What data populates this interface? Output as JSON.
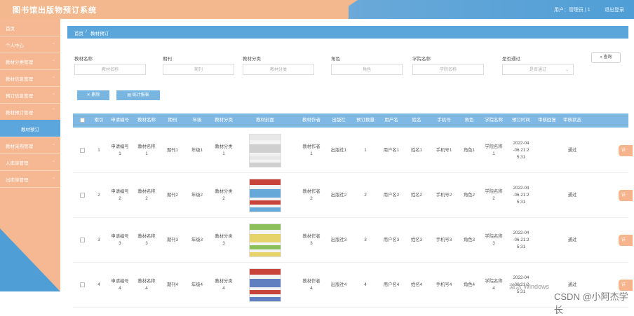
{
  "header": {
    "title": "图书馆出版物预订系统",
    "user": "用户：管理员 | 1",
    "logout": "退出登录"
  },
  "sidebar": {
    "items": [
      {
        "label": "首页",
        "chevron": ""
      },
      {
        "label": "个人中心",
        "chevron": "⌄"
      },
      {
        "label": "教材分类管理",
        "chevron": "⌄"
      },
      {
        "label": "教材信息管理",
        "chevron": "⌄"
      },
      {
        "label": "预订信息管理",
        "chevron": "⌄"
      },
      {
        "label": "教材预订管理",
        "chevron": "⌃"
      },
      {
        "label": "教材预订",
        "chevron": ""
      },
      {
        "label": "教材采购管理",
        "chevron": "⌄"
      },
      {
        "label": "入库单管理",
        "chevron": "⌄"
      },
      {
        "label": "出库单管理",
        "chevron": "⌄"
      }
    ]
  },
  "breadcrumb": {
    "home": "首页",
    "sep": "/",
    "current": "教材预订"
  },
  "filters": [
    {
      "label": "教材名称",
      "placeholder": "教材名称"
    },
    {
      "label": "期刊",
      "placeholder": "期刊"
    },
    {
      "label": "教材分类",
      "placeholder": "教材分类"
    },
    {
      "label": "角色",
      "placeholder": "角色"
    },
    {
      "label": "学院名称",
      "placeholder": "学院名称"
    },
    {
      "label": "是否通过",
      "placeholder": "是否通过"
    }
  ],
  "search_btn": "查询",
  "actions": {
    "delete": "删除",
    "export": "统计报表"
  },
  "columns": [
    "",
    "索引",
    "申请编号",
    "教材名称",
    "期刊",
    "年级",
    "教材分类",
    "教材封面",
    "教材作者",
    "出版社",
    "预订数量",
    "用户名",
    "姓名",
    "手机号",
    "角色",
    "学院名称",
    "预订时间",
    "审核回复",
    "审核状态",
    ""
  ],
  "rows": [
    {
      "index": "1",
      "apply_no": "申请编号\n1",
      "name": "教材名称\n1",
      "journal": "期刊1",
      "grade": "年级1",
      "category": "教材分类\n1",
      "author": "教材作者\n1",
      "publisher": "出版社1",
      "qty": "1",
      "username": "用户名1",
      "realname": "姓名1",
      "phone": "手机号1",
      "role": "角色1",
      "college": "学院名称\n1",
      "time": "2022-04\n-06 21:2\n5:31",
      "reply": "",
      "status": "通过",
      "op": "详"
    },
    {
      "index": "2",
      "apply_no": "申请编号\n2",
      "name": "教材名称\n2",
      "journal": "期刊2",
      "grade": "年级2",
      "category": "教材分类\n2",
      "author": "教材作者\n2",
      "publisher": "出版社2",
      "qty": "2",
      "username": "用户名2",
      "realname": "姓名2",
      "phone": "手机号2",
      "role": "角色2",
      "college": "学院名称\n2",
      "time": "2022-04\n-06 21:2\n5:31",
      "reply": "",
      "status": "通过",
      "op": "详"
    },
    {
      "index": "3",
      "apply_no": "申请编号\n3",
      "name": "教材名称\n3",
      "journal": "期刊3",
      "grade": "年级3",
      "category": "教材分类\n3",
      "author": "教材作者\n3",
      "publisher": "出版社3",
      "qty": "3",
      "username": "用户名3",
      "realname": "姓名3",
      "phone": "手机号3",
      "role": "角色3",
      "college": "学院名称\n3",
      "time": "2022-04\n-06 21:2\n5:31",
      "reply": "",
      "status": "通过",
      "op": "详"
    },
    {
      "index": "4",
      "apply_no": "申请编号\n4",
      "name": "教材名称\n4",
      "journal": "期刊4",
      "grade": "年级4",
      "category": "教材分类\n4",
      "author": "教材作者\n4",
      "publisher": "出版社4",
      "qty": "4",
      "username": "用户名4",
      "realname": "姓名4",
      "phone": "手机号4",
      "role": "角色4",
      "college": "学院名称\n4",
      "time": "2022-04\n-06 21:2\n5:31",
      "reply": "",
      "status": "通过",
      "op": "详"
    }
  ],
  "watermark": "CSDN @小阿杰学长",
  "windows_text": "激活 Windows"
}
